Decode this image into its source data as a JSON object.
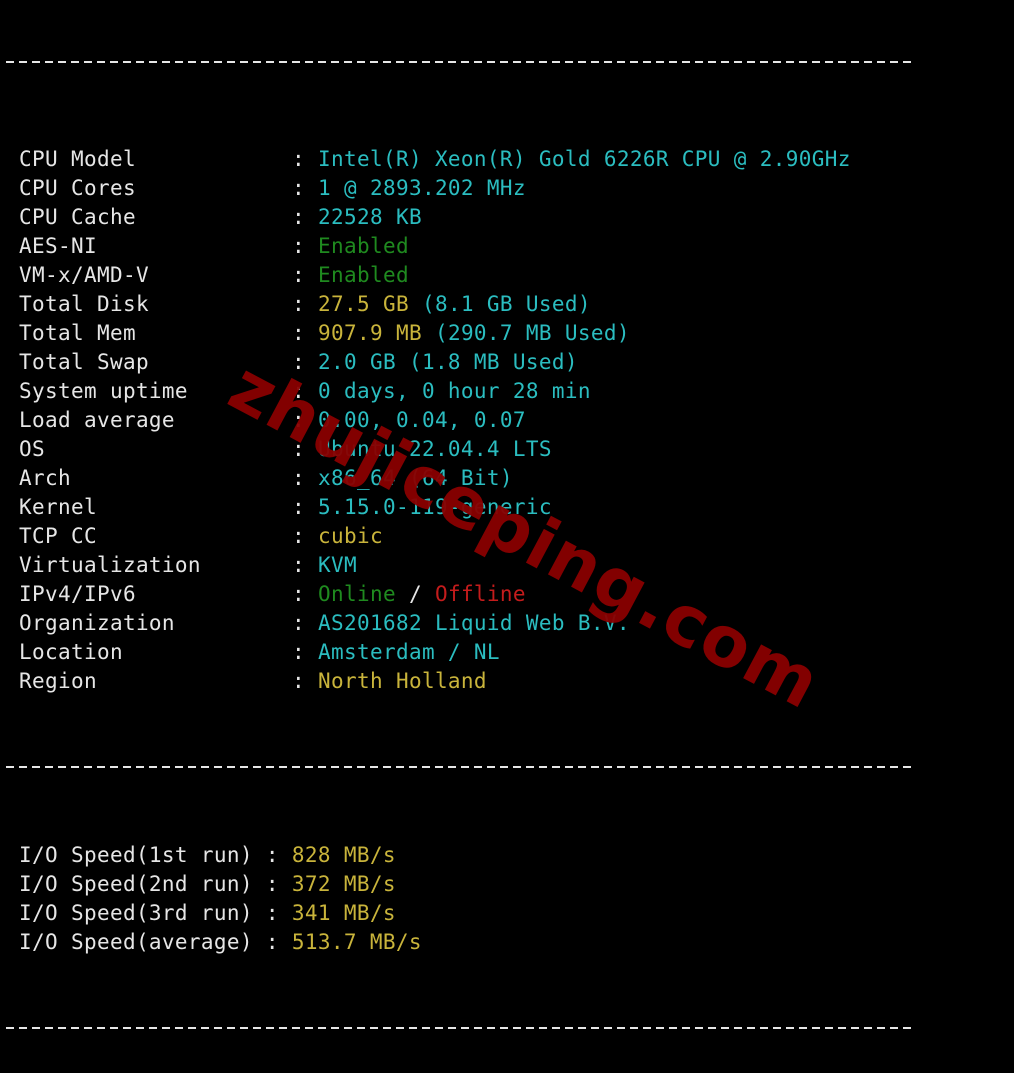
{
  "colors": {
    "background": "#000000",
    "label": "#e6e6e6",
    "cyan": "#2bbdc0",
    "yellow": "#c9b43b",
    "green": "#1f8a1f",
    "red": "#c41c1c",
    "watermark": "#8a0000"
  },
  "separator": "----------------------------------------------------------------------",
  "system_info": [
    {
      "label": "CPU Model",
      "sep": ": ",
      "parts": [
        {
          "text": "Intel(R) Xeon(R) Gold 6226R CPU @ 2.90GHz",
          "color": "cyan"
        }
      ]
    },
    {
      "label": "CPU Cores",
      "sep": ": ",
      "parts": [
        {
          "text": "1 @ 2893.202 MHz",
          "color": "cyan"
        }
      ]
    },
    {
      "label": "CPU Cache",
      "sep": ": ",
      "parts": [
        {
          "text": "22528 KB",
          "color": "cyan"
        }
      ]
    },
    {
      "label": "AES-NI",
      "sep": ": ",
      "parts": [
        {
          "text": "Enabled",
          "color": "green"
        }
      ]
    },
    {
      "label": "VM-x/AMD-V",
      "sep": ": ",
      "parts": [
        {
          "text": "Enabled",
          "color": "green"
        }
      ]
    },
    {
      "label": "Total Disk",
      "sep": ": ",
      "parts": [
        {
          "text": "27.5 GB ",
          "color": "yellow"
        },
        {
          "text": "(8.1 GB Used)",
          "color": "cyan"
        }
      ]
    },
    {
      "label": "Total Mem",
      "sep": ": ",
      "parts": [
        {
          "text": "907.9 MB ",
          "color": "yellow"
        },
        {
          "text": "(290.7 MB Used)",
          "color": "cyan"
        }
      ]
    },
    {
      "label": "Total Swap",
      "sep": ": ",
      "parts": [
        {
          "text": "2.0 GB (1.8 MB Used)",
          "color": "cyan"
        }
      ]
    },
    {
      "label": "System uptime",
      "sep": ": ",
      "parts": [
        {
          "text": "0 days, 0 hour 28 min",
          "color": "cyan"
        }
      ]
    },
    {
      "label": "Load average",
      "sep": ": ",
      "parts": [
        {
          "text": "0.00, 0.04, 0.07",
          "color": "cyan"
        }
      ]
    },
    {
      "label": "OS",
      "sep": ": ",
      "parts": [
        {
          "text": "Ubuntu 22.04.4 LTS",
          "color": "cyan"
        }
      ]
    },
    {
      "label": "Arch",
      "sep": ": ",
      "parts": [
        {
          "text": "x86_64 (64 Bit)",
          "color": "cyan"
        }
      ]
    },
    {
      "label": "Kernel",
      "sep": ": ",
      "parts": [
        {
          "text": "5.15.0-119-generic",
          "color": "cyan"
        }
      ]
    },
    {
      "label": "TCP CC",
      "sep": ": ",
      "parts": [
        {
          "text": "cubic",
          "color": "yellow"
        }
      ]
    },
    {
      "label": "Virtualization",
      "sep": ": ",
      "parts": [
        {
          "text": "KVM",
          "color": "cyan"
        }
      ]
    },
    {
      "label": "IPv4/IPv6",
      "sep": ": ",
      "parts": [
        {
          "text": "Online",
          "color": "green"
        },
        {
          "text": " / ",
          "color": "white"
        },
        {
          "text": "Offline",
          "color": "red"
        }
      ]
    },
    {
      "label": "Organization",
      "sep": ": ",
      "parts": [
        {
          "text": "AS201682 Liquid Web B.V.",
          "color": "cyan"
        }
      ]
    },
    {
      "label": "Location",
      "sep": ": ",
      "parts": [
        {
          "text": "Amsterdam / NL",
          "color": "cyan"
        }
      ]
    },
    {
      "label": "Region",
      "sep": ": ",
      "parts": [
        {
          "text": "North Holland",
          "color": "yellow"
        }
      ]
    }
  ],
  "io_speed": [
    {
      "label": "I/O Speed(1st run) ",
      "sep": ": ",
      "value": "828 MB/s"
    },
    {
      "label": "I/O Speed(2nd run) ",
      "sep": ": ",
      "value": "372 MB/s"
    },
    {
      "label": "I/O Speed(3rd run) ",
      "sep": ": ",
      "value": "341 MB/s"
    },
    {
      "label": "I/O Speed(average) ",
      "sep": ": ",
      "value": "513.7 MB/s"
    }
  ],
  "watermark": "zhujiceping.com"
}
